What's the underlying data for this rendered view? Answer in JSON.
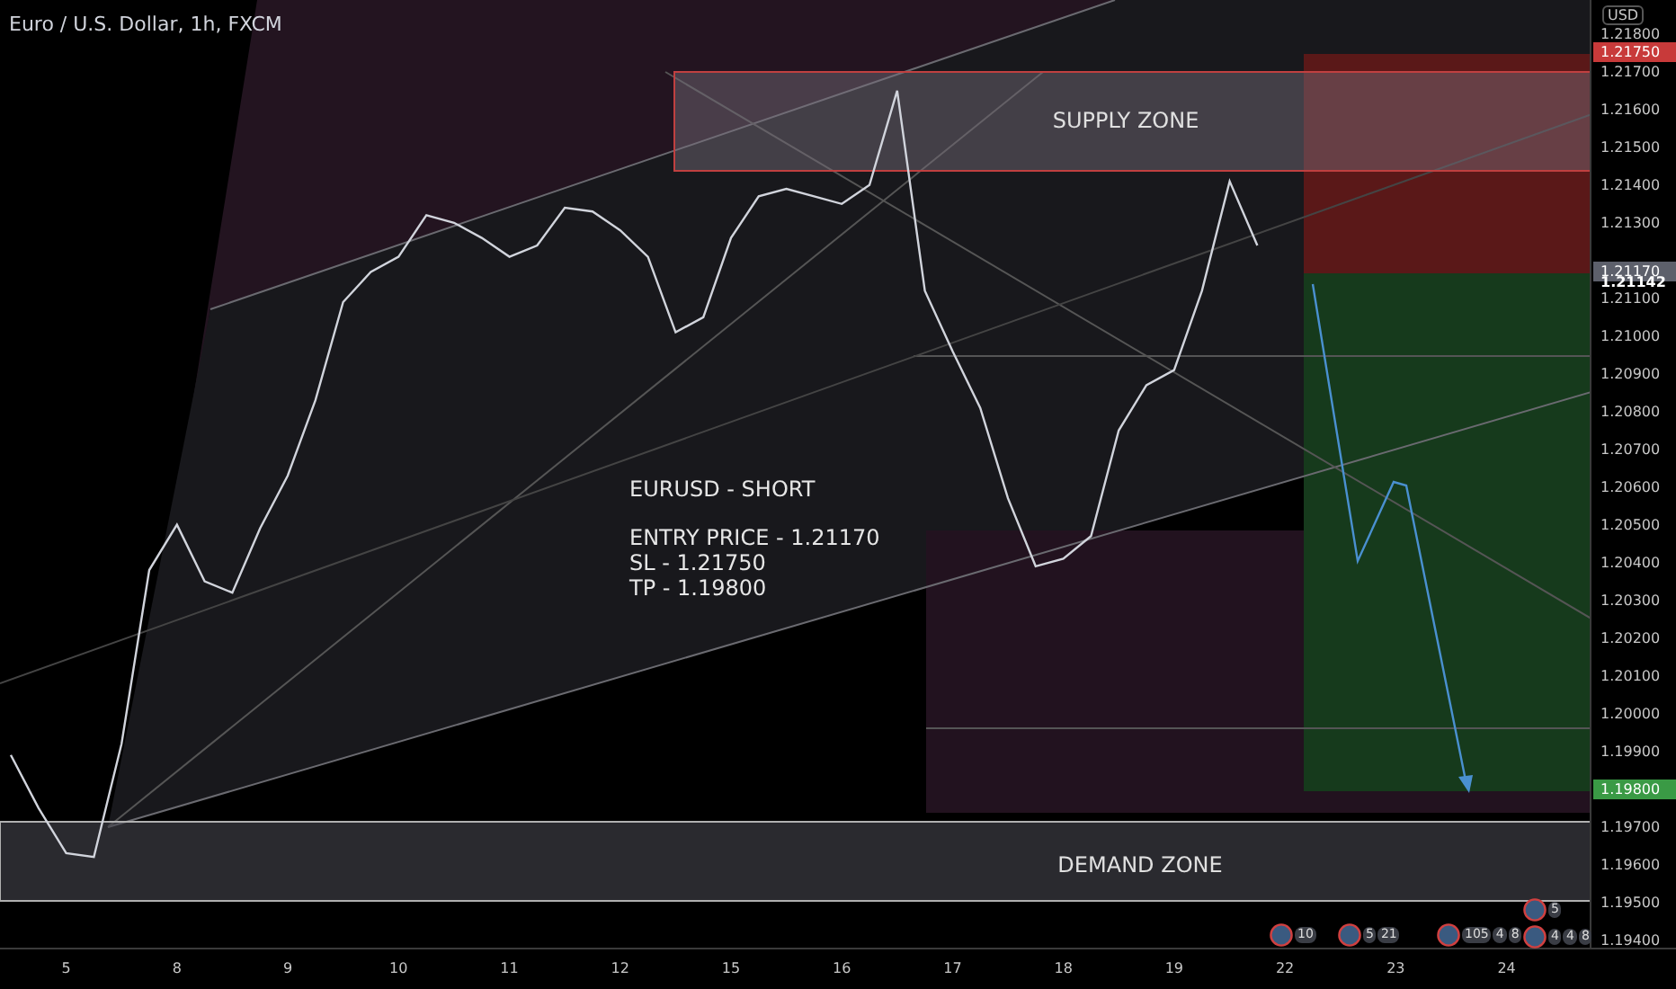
{
  "header": {
    "title": "Euro / U.S. Dollar, 1h, FXCM"
  },
  "price_axis": {
    "currency": "USD",
    "badges": [
      {
        "label": "1.21750",
        "kind": "stop",
        "color": "#c83a3a"
      },
      {
        "label": "1.21170",
        "kind": "entry",
        "color": "#5d606b"
      },
      {
        "label": "1.21142",
        "kind": "last"
      },
      {
        "label": "1.19800",
        "kind": "target",
        "color": "#3a9a45"
      }
    ]
  },
  "chart": {
    "chart_data": {
      "type": "line",
      "categories": [
        null,
        null,
        "5",
        null,
        null,
        null,
        "8",
        null,
        null,
        null,
        "9",
        null,
        null,
        null,
        "10",
        null,
        null,
        null,
        "11",
        null,
        null,
        null,
        "12",
        null,
        null,
        null,
        "15",
        null,
        null,
        null,
        "16",
        null,
        null,
        null,
        "17",
        null,
        null,
        null,
        "18",
        null,
        null,
        null,
        "19",
        null,
        null,
        null,
        "22",
        null,
        null,
        null,
        "23",
        null,
        null,
        null,
        "24",
        null,
        null
      ],
      "series": [
        {
          "color": "#d1d4dc",
          "values": [
            1.1989,
            1.1975,
            1.1963,
            1.1962,
            1.1992,
            1.2038,
            1.205,
            1.2035,
            1.2032,
            1.2049,
            1.2063,
            1.2083,
            1.2109,
            1.2117,
            1.2121,
            1.2132,
            1.213,
            1.2126,
            1.2121,
            1.2124,
            1.2134,
            1.2133,
            1.2128,
            1.2121,
            1.2101,
            1.2105,
            1.2126,
            1.2137,
            1.2139,
            1.2137,
            1.2135,
            1.214,
            1.2165,
            1.2112,
            1.2096,
            1.2081,
            1.2057,
            1.2039,
            1.2041,
            1.2047,
            1.2075,
            1.2087,
            1.2091,
            1.2112,
            1.2141,
            1.2124,
            null,
            null,
            null,
            null,
            null,
            null,
            null,
            null,
            null,
            null,
            null
          ]
        }
      ],
      "ylim": [
        1.1938,
        1.2189
      ],
      "yticks": [
        {
          "value": 1.194,
          "label": "1.19400"
        },
        {
          "value": 1.195,
          "label": "1.19500"
        },
        {
          "value": 1.196,
          "label": "1.19600"
        },
        {
          "value": 1.197,
          "label": "1.19700"
        },
        {
          "value": 1.199,
          "label": "1.19900"
        },
        {
          "value": 1.2,
          "label": "1.20000"
        },
        {
          "value": 1.201,
          "label": "1.20100"
        },
        {
          "value": 1.202,
          "label": "1.20200"
        },
        {
          "value": 1.203,
          "label": "1.20300"
        },
        {
          "value": 1.204,
          "label": "1.20400"
        },
        {
          "value": 1.205,
          "label": "1.20500"
        },
        {
          "value": 1.206,
          "label": "1.20600"
        },
        {
          "value": 1.207,
          "label": "1.20700"
        },
        {
          "value": 1.208,
          "label": "1.20800"
        },
        {
          "value": 1.209,
          "label": "1.20900"
        },
        {
          "value": 1.21,
          "label": "1.21000"
        },
        {
          "value": 1.211,
          "label": "1.21100"
        },
        {
          "value": 1.213,
          "label": "1.21300"
        },
        {
          "value": 1.214,
          "label": "1.21400"
        },
        {
          "value": 1.215,
          "label": "1.21500"
        },
        {
          "value": 1.216,
          "label": "1.21600"
        },
        {
          "value": 1.217,
          "label": "1.21700"
        },
        {
          "value": 1.218,
          "label": "1.21800"
        }
      ]
    }
  },
  "zones": [
    {
      "label": "SUPPLY ZONE",
      "kind": "supply"
    },
    {
      "label": "DEMAND ZONE",
      "kind": "demand"
    }
  ],
  "note": {
    "title": "EURUSD - SHORT",
    "lines": [
      "ENTRY PRICE - 1.21170",
      "SL - 1.21750",
      "TP - 1.19800"
    ]
  },
  "events": [
    {
      "counts": [
        "10"
      ]
    },
    {
      "counts": [
        "5",
        "21"
      ]
    },
    {
      "counts": [
        "105",
        "4",
        "8"
      ]
    },
    {
      "counts": [
        "5"
      ]
    },
    {
      "counts": [
        "4",
        "4",
        "8"
      ]
    }
  ]
}
